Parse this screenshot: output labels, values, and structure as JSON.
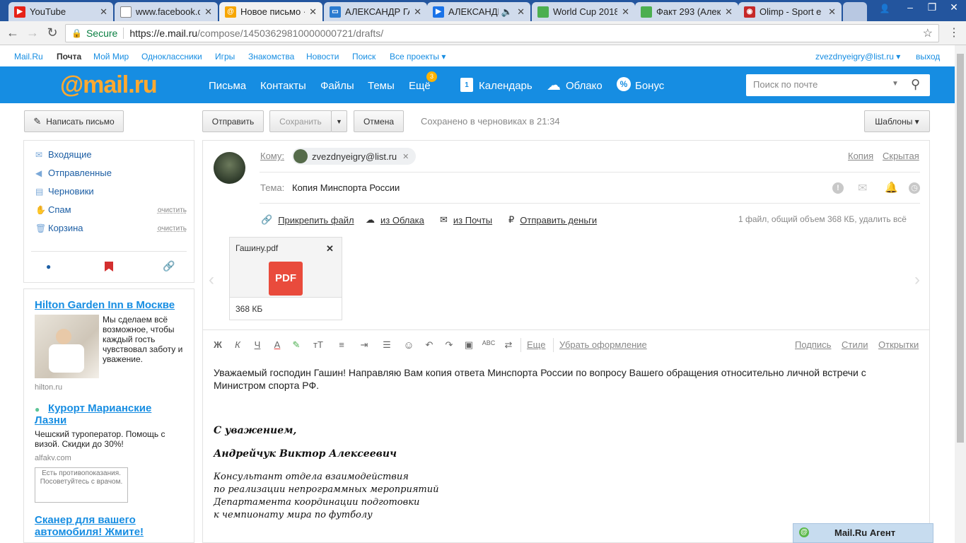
{
  "tabs": [
    {
      "title": "YouTube",
      "icon": "youtube-icon",
      "color": "#e62117",
      "active": false
    },
    {
      "title": "www.facebook.c",
      "icon": "page-icon",
      "color": "#888888",
      "active": false
    },
    {
      "title": "Новое письмо ·",
      "icon": "mailru-at-icon",
      "color": "#f7a600",
      "active": true
    },
    {
      "title": "АЛЕКСАНДР ГА",
      "icon": "vk-video-icon",
      "color": "#2b7bd0",
      "active": false
    },
    {
      "title": "АЛЕКСАНДР",
      "icon": "play-icon",
      "color": "#1a73e8",
      "active": false
    },
    {
      "title": "World Cup 2018",
      "icon": "sheet-icon",
      "color": "#4caf50",
      "active": false
    },
    {
      "title": "Факт 293 (Алек",
      "icon": "sheet-icon",
      "color": "#4caf50",
      "active": false
    },
    {
      "title": "Olimp - Sport e",
      "icon": "olimp-icon",
      "color": "#c62828",
      "active": false
    }
  ],
  "address": {
    "secure_label": "Secure",
    "host": "https://e.mail.ru",
    "path": "/compose/14503629810000000721/drafts/"
  },
  "portal": {
    "links": [
      "Mail.Ru",
      "Почта",
      "Мой Мир",
      "Одноклассники",
      "Игры",
      "Знакомства",
      "Новости",
      "Поиск",
      "Все проекты ▾"
    ],
    "user": "zvezdnyeigry@list.ru ▾",
    "logout": "выход"
  },
  "header": {
    "logo_at": "@",
    "logo_text": "mail.ru",
    "nav": [
      "Письма",
      "Контакты",
      "Файлы",
      "Темы",
      "Ещё"
    ],
    "more_badge": "3",
    "nav_right": [
      "Календарь",
      "Облако",
      "Бонус"
    ],
    "calendar_day": "1",
    "search_placeholder": "Поиск по почте"
  },
  "actions": {
    "write": "Написать письмо",
    "send": "Отправить",
    "save": "Сохранить",
    "cancel": "Отмена",
    "saved_prefix": "Сохранено в ",
    "saved_link": "черновиках",
    "saved_suffix": " в 21:34",
    "templates": "Шаблоны ▾"
  },
  "folders": [
    {
      "label": "Входящие",
      "icon": "envelope-icon",
      "clean": ""
    },
    {
      "label": "Отправленные",
      "icon": "sent-arrow-icon",
      "clean": ""
    },
    {
      "label": "Черновики",
      "icon": "draft-icon",
      "clean": ""
    },
    {
      "label": "Спам",
      "icon": "thumbs-down-icon",
      "clean": "очистить"
    },
    {
      "label": "Корзина",
      "icon": "trash-icon",
      "clean": "очистить"
    }
  ],
  "ads": {
    "ad1": {
      "title": "Hilton Garden Inn в Москве",
      "text": "Мы сделаем всё возможное, чтобы каждый гость чувствовал заботу и уважение.",
      "domain": "hilton.ru"
    },
    "ad2": {
      "title": "Курорт Марианские Лазни",
      "text": "Чешский туроператор. Помощь с визой. Скидки до 30%!",
      "domain": "alfakv.com",
      "warning": "Есть противопоказания. Посоветуйтесь с врачом."
    },
    "ad3": {
      "title": "Сканер для вашего автомобиля! Жмите!"
    }
  },
  "compose": {
    "to_label": "Кому:",
    "recipient": "zvezdnyeigry@list.ru",
    "copy": "Копия",
    "bcc": "Скрытая",
    "subject_label": "Тема:",
    "subject": "Копия Минспорта России",
    "attach_file": "Прикрепить файл",
    "from_cloud": "из Облака",
    "from_mail": "из Почты",
    "send_money": "Отправить деньги",
    "files_summary": "1 файл, общий объем 368 КБ, ",
    "delete_all": "удалить всё",
    "attachment": {
      "name": "Гашину.pdf",
      "type": "PDF",
      "size": "368 КБ"
    },
    "format_toolbar": {
      "more": "Еще",
      "remove_format": "Убрать оформление",
      "signature": "Подпись",
      "styles": "Стили",
      "postcards": "Открытки"
    },
    "body_line1": "Уважаемый господин Гашин! Направляю Вам копия ответа Минспорта России по вопросу  Вашего обращения относительно личной  встречи с",
    "body_line2": "Министром спорта РФ.",
    "sig_greeting": "С уважением,",
    "sig_name": "Андрейчук Виктор Алексеевич",
    "sig_lines": [
      "Консультант отдела взаимодействия",
      "по реализации непрограммных мероприятий",
      "Департамента координации подготовки",
      "к чемпионату мира по футболу"
    ]
  },
  "agent": {
    "label": "Mail.Ru Агент"
  }
}
